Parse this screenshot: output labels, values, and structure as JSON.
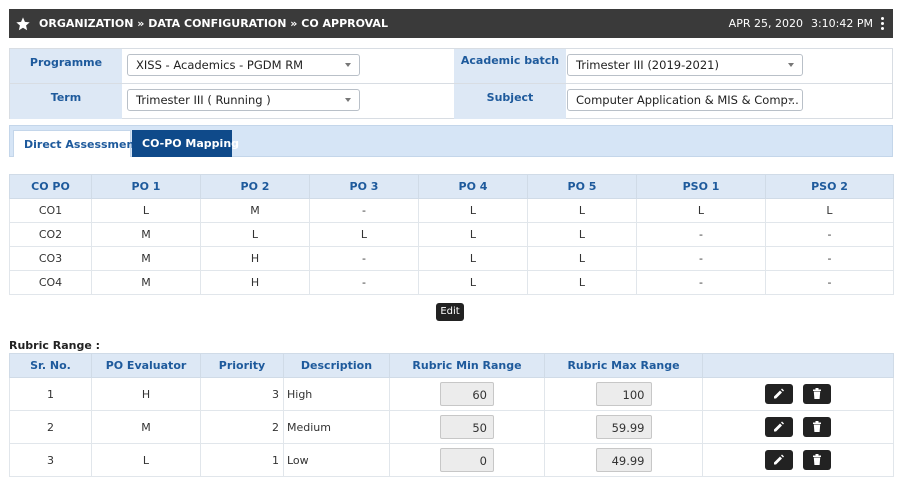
{
  "header": {
    "title": "ORGANIZATION » DATA CONFIGURATION » CO APPROVAL",
    "date": "APR 25, 2020",
    "time": "3:10:42 PM"
  },
  "filters": {
    "programme_label": "Programme",
    "programme_value": "XISS - Academics - PGDM RM",
    "academic_batch_label": "Academic batch",
    "academic_batch_value": "Trimester III (2019-2021)",
    "term_label": "Term",
    "term_value": "Trimester III ( Running )",
    "subject_label": "Subject",
    "subject_value": "Computer Application & MIS & Comp..."
  },
  "tabs": [
    {
      "label": "Direct Assessment",
      "active": false
    },
    {
      "label": "CO-PO Mapping",
      "active": true
    }
  ],
  "copo_table": {
    "headers": [
      "CO PO",
      "PO 1",
      "PO 2",
      "PO 3",
      "PO 4",
      "PO 5",
      "PSO 1",
      "PSO 2"
    ],
    "rows": [
      [
        "CO1",
        "L",
        "M",
        "-",
        "L",
        "L",
        "L",
        "L"
      ],
      [
        "CO2",
        "M",
        "L",
        "L",
        "L",
        "L",
        "-",
        "-"
      ],
      [
        "CO3",
        "M",
        "H",
        "-",
        "L",
        "L",
        "-",
        "-"
      ],
      [
        "CO4",
        "M",
        "H",
        "-",
        "L",
        "L",
        "-",
        "-"
      ]
    ]
  },
  "edit_label": "Edit",
  "rubric": {
    "title": "Rubric Range :",
    "headers": [
      "Sr. No.",
      "PO Evaluator",
      "Priority",
      "Description",
      "Rubric Min Range",
      "Rubric Max Range",
      ""
    ],
    "rows": [
      {
        "sr": "1",
        "evaluator": "H",
        "priority": "3",
        "description": "High",
        "min": "60",
        "max": "100"
      },
      {
        "sr": "2",
        "evaluator": "M",
        "priority": "2",
        "description": "Medium",
        "min": "50",
        "max": "59.99"
      },
      {
        "sr": "3",
        "evaluator": "L",
        "priority": "1",
        "description": "Low",
        "min": "0",
        "max": "49.99"
      }
    ]
  },
  "colors": {
    "header_bg": "#3a3a3a",
    "label_bg": "#dde8f5",
    "label_text": "#1e5a9c",
    "active_tab": "#0f4a8a"
  }
}
